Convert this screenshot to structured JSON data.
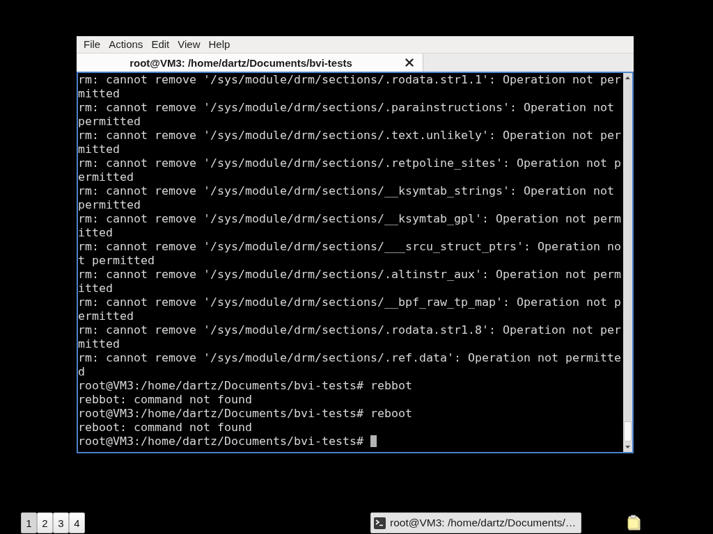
{
  "window": {
    "menu": [
      "File",
      "Actions",
      "Edit",
      "View",
      "Help"
    ],
    "tabs": [
      {
        "label": "root@VM3: /home/dartz/Documents/bvi-tests",
        "selected": true
      }
    ]
  },
  "terminal": {
    "lines": [
      "rm: cannot remove '/sys/module/drm/sections/.rodata.str1.1': Operation not permitted",
      "rm: cannot remove '/sys/module/drm/sections/.parainstructions': Operation not permitted",
      "rm: cannot remove '/sys/module/drm/sections/.text.unlikely': Operation not permitted",
      "rm: cannot remove '/sys/module/drm/sections/.retpoline_sites': Operation not permitted",
      "rm: cannot remove '/sys/module/drm/sections/__ksymtab_strings': Operation not permitted",
      "rm: cannot remove '/sys/module/drm/sections/__ksymtab_gpl': Operation not permitted",
      "rm: cannot remove '/sys/module/drm/sections/___srcu_struct_ptrs': Operation not permitted",
      "rm: cannot remove '/sys/module/drm/sections/.altinstr_aux': Operation not permitted",
      "rm: cannot remove '/sys/module/drm/sections/__bpf_raw_tp_map': Operation not permitted",
      "rm: cannot remove '/sys/module/drm/sections/.rodata.str1.8': Operation not permitted",
      "rm: cannot remove '/sys/module/drm/sections/.ref.data': Operation not permitted",
      "root@VM3:/home/dartz/Documents/bvi-tests# rebbot",
      "rebbot: command not found",
      "root@VM3:/home/dartz/Documents/bvi-tests# reboot",
      "reboot: command not found",
      "root@VM3:/home/dartz/Documents/bvi-tests#"
    ],
    "cursor": true
  },
  "taskbar": {
    "workspaces": [
      {
        "label": "1",
        "selected": true
      },
      {
        "label": "2",
        "selected": false
      },
      {
        "label": "3",
        "selected": false
      },
      {
        "label": "4",
        "selected": false
      }
    ],
    "tasks": [
      {
        "label": "root@VM3: /home/dartz/Documents/…"
      }
    ]
  }
}
